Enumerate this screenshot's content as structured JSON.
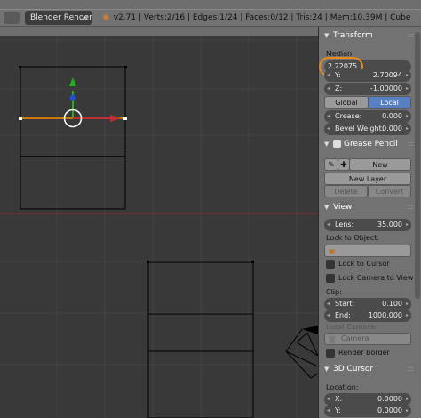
{
  "topbar": {
    "render_engine": "Blender Render",
    "version": "v2.71",
    "verts": "Verts:2/16",
    "edges": "Edges:1/24",
    "faces": "Faces:0/12",
    "tris": "Tris:24",
    "mem": "Mem:10.39M",
    "object": "Cube",
    "sep": "|"
  },
  "transform": {
    "title": "Transform",
    "median_label": "Median:",
    "x_value": "2.22075",
    "y_label": "Y:",
    "y_value": "2.70094",
    "z_label": "Z:",
    "z_value": "-1.00000",
    "global_label": "Global",
    "local_label": "Local",
    "crease_label": "Crease:",
    "crease_value": "0.000",
    "bevel_label": "Bevel Weight:",
    "bevel_value": "0.000"
  },
  "grease_pencil": {
    "title": "Grease Pencil",
    "new_label": "New",
    "new_layer_label": "New Layer",
    "delete_frame_label": "Delete Fra...",
    "convert_label": "Convert"
  },
  "view": {
    "title": "View",
    "lens_label": "Lens:",
    "lens_value": "35.000",
    "lock_object_label": "Lock to Object:",
    "lock_cursor_label": "Lock to Cursor",
    "lock_camera_label": "Lock Camera to View",
    "clip_label": "Clip:",
    "start_label": "Start:",
    "start_value": "0.100",
    "end_label": "End:",
    "end_value": "1000.000",
    "local_camera_label": "Local Camera:",
    "camera_value": "Camera",
    "render_border_label": "Render Border"
  },
  "cursor3d": {
    "title": "3D Cursor",
    "location_label": "Location:",
    "x_label": "X:",
    "x_value": "0.0000",
    "y_label": "Y:",
    "y_value": "0.0000"
  },
  "colors": {
    "accent": "#5680c2",
    "highlight_ring": "#e98a1a",
    "x_axis": "#c03030",
    "y_axis": "#20b020",
    "z_axis": "#2050d0",
    "selected_edge": "#ff8c00"
  }
}
